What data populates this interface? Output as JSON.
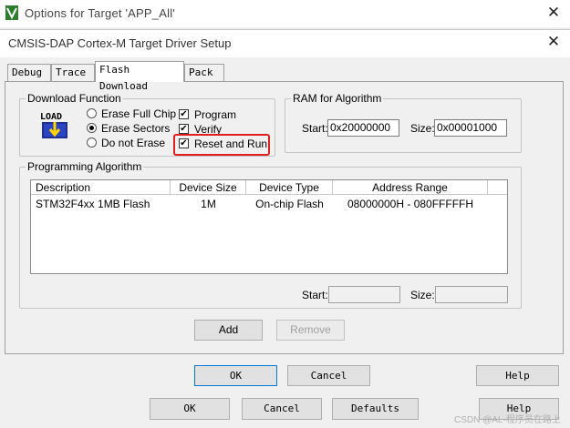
{
  "outer_window": {
    "title": "Options for Target 'APP_All'",
    "buttons": {
      "ok": "OK",
      "cancel": "Cancel",
      "defaults": "Defaults",
      "help": "Help"
    }
  },
  "dialog": {
    "title": "CMSIS-DAP Cortex-M Target Driver Setup",
    "tabs": [
      {
        "label": "Debug"
      },
      {
        "label": "Trace"
      },
      {
        "label": "Flash Download"
      },
      {
        "label": "Pack"
      }
    ],
    "active_tab": "Flash Download",
    "download_function": {
      "label": "Download Function",
      "icon_text": "LOAD",
      "erase_options": [
        {
          "label": "Erase Full Chip",
          "selected": false
        },
        {
          "label": "Erase Sectors",
          "selected": true
        },
        {
          "label": "Do not Erase",
          "selected": false
        }
      ],
      "checks": [
        {
          "label": "Program",
          "checked": true
        },
        {
          "label": "Verify",
          "checked": true
        },
        {
          "label": "Reset and Run",
          "checked": true
        }
      ]
    },
    "ram_for_algorithm": {
      "label": "RAM for Algorithm",
      "start_label": "Start:",
      "start_value": "0x20000000",
      "size_label": "Size:",
      "size_value": "0x00001000"
    },
    "programming_algorithm": {
      "label": "Programming Algorithm",
      "columns": [
        "Description",
        "Device Size",
        "Device Type",
        "Address Range"
      ],
      "rows": [
        {
          "description": "STM32F4xx 1MB Flash",
          "device_size": "1M",
          "device_type": "On-chip Flash",
          "address_range": "08000000H - 080FFFFFH"
        }
      ],
      "start_label": "Start:",
      "start_value": "",
      "size_label": "Size:",
      "size_value": "",
      "add_label": "Add",
      "remove_label": "Remove"
    },
    "buttons": {
      "ok": "OK",
      "cancel": "Cancel",
      "help": "Help"
    }
  },
  "watermark": "CSDN @AL-程序员在路上",
  "colors": {
    "highlight": "#e02020",
    "focus_border": "#0078d7"
  }
}
